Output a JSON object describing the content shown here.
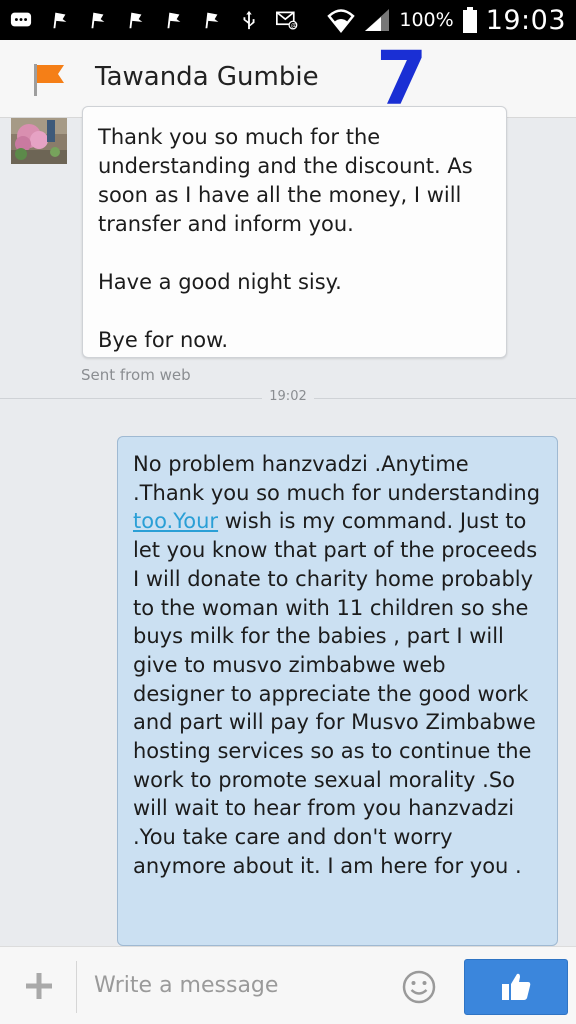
{
  "status_bar": {
    "icons_left": [
      "message-icon",
      "flag-icon",
      "flag-icon",
      "flag-icon",
      "flag-icon",
      "flag-icon",
      "usb-icon",
      "email-icon"
    ],
    "battery_text": "100%",
    "time": "19:03"
  },
  "header": {
    "contact_name": "Tawanda Gumbie",
    "annotation": "7"
  },
  "messages": {
    "incoming": {
      "text": "Thank you so much for the\nunderstanding and the discount. As\nsoon as I have all the money, I will\ntransfer and inform you.\n\nHave a good night sisy.\n\nBye for now.",
      "meta": "Sent from web"
    },
    "divider_time": "19:02",
    "outgoing": {
      "text_before_link": "No problem hanzvadzi .Anytime .Thank you so much for understanding ",
      "link_text": "too.Your",
      "text_after_link": " wish is my command. Just to let you know that part of the proceeds I will donate to charity home probably to the woman with 11 children so she buys milk for the babies , part I will give to musvo zimbabwe web designer to appreciate the good work and part will pay for Musvo Zimbabwe hosting services so as to continue the work to promote sexual morality .So will wait to hear from you hanzvadzi .You take care and don't worry anymore about it. I am here for you ."
    }
  },
  "composer": {
    "placeholder": "Write a message"
  },
  "colors": {
    "accent": "#3b86dc",
    "outgoing_bubble": "#cbe0f2",
    "flag": "#f57f17",
    "annotation": "#1a2fd4"
  }
}
